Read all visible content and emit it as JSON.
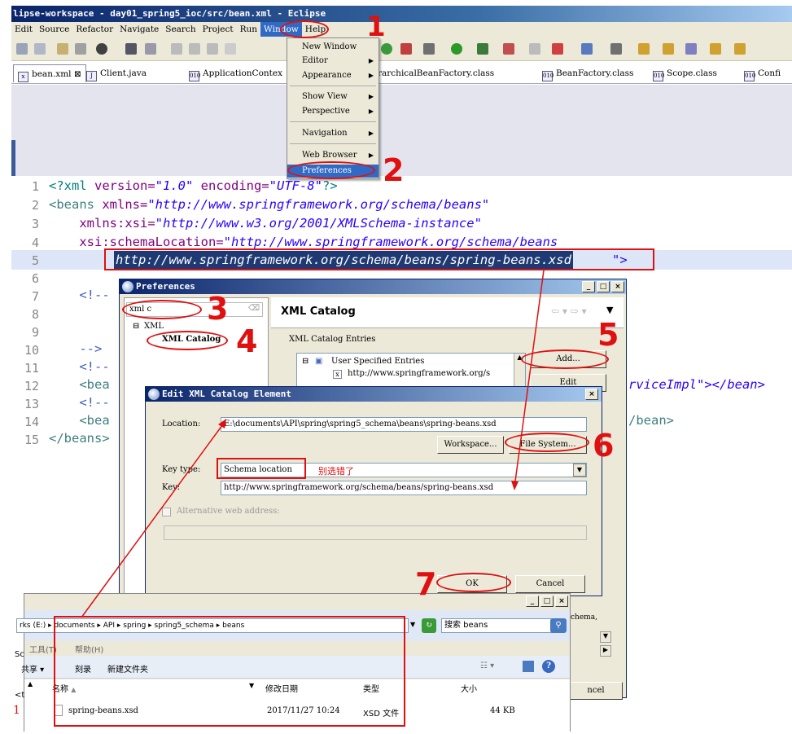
{
  "window": {
    "title": "lipse-workspace - day01_spring5_ioc/src/bean.xml - Eclipse"
  },
  "menubar": [
    "Edit",
    "Source",
    "Refactor",
    "Navigate",
    "Search",
    "Project",
    "Run",
    "Window",
    "Help"
  ],
  "tabs": [
    {
      "label": "bean.xml",
      "close": "⊠"
    },
    {
      "label": "Client.java"
    },
    {
      "label": "ApplicationContex"
    },
    {
      "label": "rarchicalBeanFactory.class"
    },
    {
      "label": "BeanFactory.class"
    },
    {
      "label": "Scope.class"
    },
    {
      "label": "Confi"
    }
  ],
  "window_menu": {
    "items": [
      {
        "label": "New Window"
      },
      {
        "label": "Editor",
        "arrow": "▶"
      },
      {
        "label": "Appearance",
        "arrow": "▶"
      },
      {
        "label": "Show View",
        "arrow": "▶"
      },
      {
        "label": "Perspective",
        "arrow": "▶"
      },
      {
        "label": "Navigation",
        "arrow": "▶"
      },
      {
        "label": "Web Browser",
        "arrow": "▶"
      },
      {
        "label": "Preferences"
      }
    ]
  },
  "code": {
    "line_numbers": [
      "1",
      "2",
      "3",
      "4",
      "5",
      "6",
      "7",
      "8",
      "9",
      "10",
      "11",
      "12",
      "13",
      "14",
      "15"
    ],
    "l1": {
      "a": "<?xml ",
      "b": "version=",
      "c": "\"1.0\"",
      "d": " encoding=",
      "e": "\"UTF-8\"",
      "f": "?>"
    },
    "l2": {
      "a": "<beans ",
      "b": "xmlns=",
      "c": "\"http://www.springframework.org/schema/beans\""
    },
    "l3": {
      "b": "    xmlns:xsi=",
      "c": "\"http://www.w3.org/2001/XMLSchema-instance\""
    },
    "l4": {
      "b": "    xsi:schemaLocation=",
      "c": "\"http://www.springframework.org/schema/beans"
    },
    "l5_selected": "http://www.springframework.org/schema/beans/spring-beans.xsd",
    "l5_tail": "\">",
    "l7": "    <!--",
    "l10": "    -->",
    "l11": "    <!--",
    "l12": "    <bea",
    "l12_right": "rviceImpl\"></bean>",
    "l13": "    <!--",
    "l14": "    <bea",
    "l14_right": "/bean>",
    "l15": "</beans>"
  },
  "preferences": {
    "title": "Preferences",
    "filter_value": "xml c",
    "tree_parent": "XML",
    "tree_child": "XML Catalog",
    "page_title": "XML Catalog",
    "group_label": "XML Catalog Entries",
    "entry_root": "User Specified Entries",
    "entry_child": "http://www.springframework.org/s",
    "add_button": "Add...",
    "edit_button": "Edit",
    "cancel_button": "ncel",
    "side_text": "chema,"
  },
  "edit_dialog": {
    "title": "Edit XML Catalog Element",
    "location_label": "Location:",
    "location_value": "E:\\documents\\API\\spring\\spring5_schema\\beans\\spring-beans.xsd",
    "workspace_button": "Workspace...",
    "filesystem_button": "File System...",
    "keytype_label": "Key type:",
    "keytype_value": "Schema location",
    "warning_note": "别选错了",
    "key_label": "Key:",
    "key_value": "http://www.springframework.org/schema/beans/spring-beans.xsd",
    "alt_label": "Alternative web address:",
    "ok_button": "OK",
    "cancel_button": "Cancel"
  },
  "explorer": {
    "path": "rks (E:) ▸ documents ▸ API ▸ spring ▸ spring5_schema ▸ beans",
    "search_placeholder": "搜索 beans",
    "menu_tools": "工具(T)",
    "menu_help": "帮助(H)",
    "cmd_share": "共享 ▾",
    "cmd_burn": "刻录",
    "cmd_newfolder": "新建文件夹",
    "col_name": "名称",
    "col_date": "修改日期",
    "col_type": "类型",
    "col_size": "大小",
    "file_name": "spring-beans.xsd",
    "file_date": "2017/11/27 10:24",
    "file_type": "XSD 文件",
    "file_size": "44 KB",
    "left_frag1": "Sc",
    "left_frag2": "<t"
  },
  "annotations": [
    "1",
    "2",
    "3",
    "4",
    "5",
    "6",
    "7"
  ]
}
